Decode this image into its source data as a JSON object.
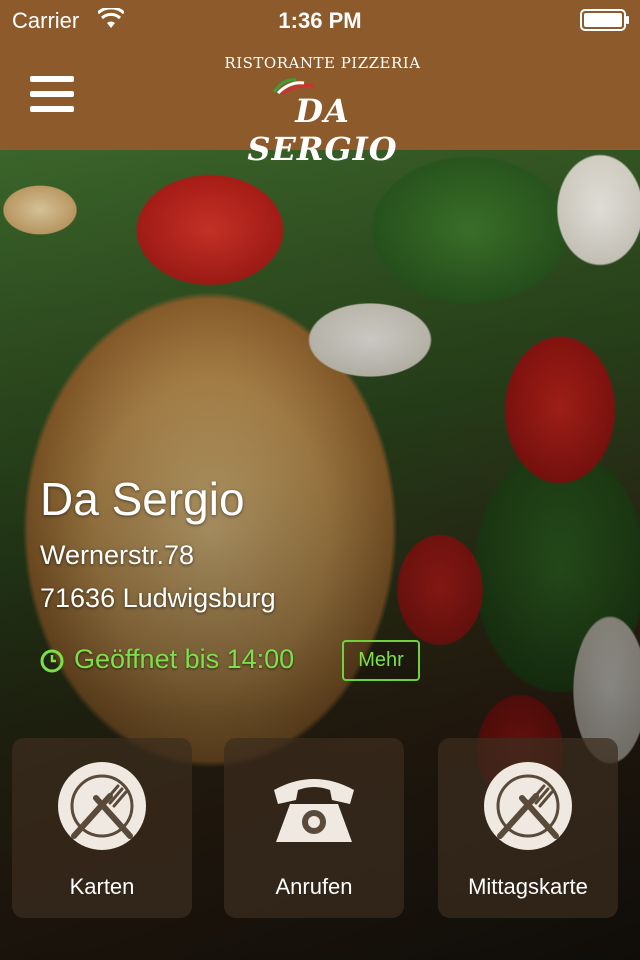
{
  "status_bar": {
    "carrier": "Carrier",
    "time": "1:36 PM",
    "icons": [
      "wifi-icon",
      "battery-icon"
    ]
  },
  "header": {
    "menu_icon": "hamburger-menu-icon",
    "logo": {
      "subtitle": "RISTORANTE PIZZERIA",
      "title": "DA SERGIO"
    },
    "colors": {
      "header_bg": "#8c5a2b"
    }
  },
  "restaurant": {
    "name": "Da Sergio",
    "street": "Wernerstr.78",
    "city": "71636 Ludwigsburg",
    "opening_status": "Geöffnet bis 14:00",
    "more_label": "Mehr",
    "colors": {
      "open_status": "#7de04a"
    }
  },
  "tiles": [
    {
      "label": "Karten",
      "icon": "plate-cutlery-icon"
    },
    {
      "label": "Anrufen",
      "icon": "telephone-icon"
    },
    {
      "label": "Mittagskarte",
      "icon": "plate-cutlery-icon"
    }
  ]
}
